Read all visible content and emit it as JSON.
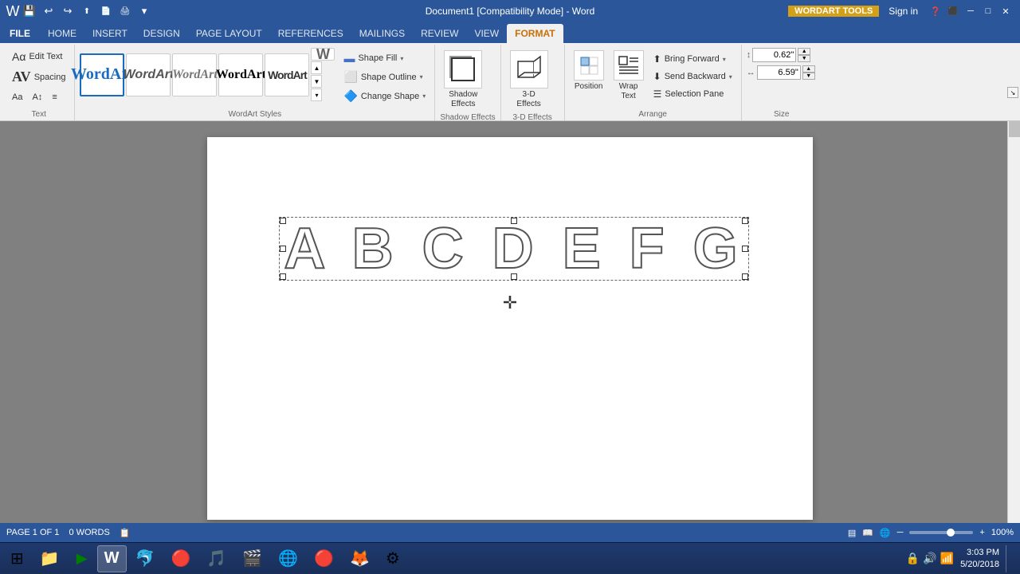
{
  "titleBar": {
    "title": "Document1 [Compatibility Mode] - Word",
    "wordartTools": "WORDART TOOLS",
    "signIn": "Sign in",
    "buttons": [
      "─",
      "□",
      "✕"
    ]
  },
  "quickAccess": {
    "buttons": [
      "💾",
      "↩",
      "↪",
      "⬆",
      "📄",
      "🖨",
      "📋"
    ]
  },
  "ribbonTabs": {
    "tabs": [
      "FILE",
      "HOME",
      "INSERT",
      "DESIGN",
      "PAGE LAYOUT",
      "REFERENCES",
      "MAILINGS",
      "REVIEW",
      "VIEW"
    ],
    "activeTab": "FORMAT",
    "contextualLabel": "WORDART TOOLS"
  },
  "ribbon": {
    "groups": {
      "text": {
        "label": "Text",
        "editText": "Edit Text",
        "spacing": "Spacing",
        "evenHeight": "Even Height",
        "vertical": "Vertical",
        "alignText": "Align Text"
      },
      "wordartStyles": {
        "label": "WordArt Styles",
        "styles": [
          "WordArt",
          "WordArt",
          "WordArt",
          "WordArt",
          "WordArt",
          "W"
        ],
        "shapeFill": "Shape Fill",
        "shapeOutline": "Shape Outline",
        "changeShape": "Change Shape"
      },
      "shadowEffects": {
        "label": "Shadow Effects",
        "btnLabel": "Shadow\nEffects"
      },
      "threeDEffects": {
        "label": "3-D Effects",
        "btnLabel": "3-D\nEffects"
      },
      "arrange": {
        "label": "Arrange",
        "position": "Position",
        "wrapText": "Wrap\nText",
        "bringForward": "Bring Forward",
        "sendBackward": "Send Backward",
        "selectionPane": "Selection Pane"
      },
      "size": {
        "label": "Size",
        "height": "0.62\"",
        "width": "6.59\""
      }
    }
  },
  "document": {
    "wordartContent": "A B C D E F G"
  },
  "statusBar": {
    "page": "PAGE 1 OF 1",
    "words": "0 WORDS",
    "zoom": "100%"
  },
  "taskbar": {
    "time": "3:03 PM",
    "date": "5/20/2018",
    "apps": [
      "⊞",
      "📁",
      "▶",
      "W",
      "🐬",
      "🔴",
      "🎵",
      "🎬",
      "🌐",
      "🔴",
      "🦊",
      "⚙"
    ]
  }
}
